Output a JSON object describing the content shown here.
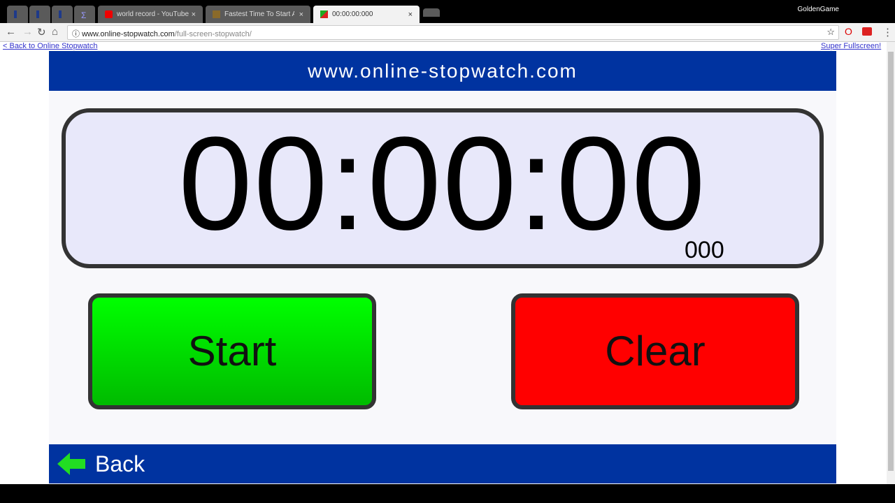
{
  "browser": {
    "tabs": [
      {
        "label": "",
        "icon": "L"
      },
      {
        "label": "",
        "icon": "L"
      },
      {
        "label": "",
        "icon": "L"
      },
      {
        "label": "",
        "icon": "sigma"
      },
      {
        "label": "world record - YouTube",
        "icon": "youtube"
      },
      {
        "label": "Fastest Time To Start An",
        "icon": "trophy"
      },
      {
        "label": "00:00:00:000",
        "icon": "stopwatch",
        "active": true
      }
    ],
    "user": "GoldenGame",
    "url_host": "www.online-stopwatch.com",
    "url_path": "/full-screen-stopwatch/"
  },
  "page": {
    "back_link": "< Back to Online Stopwatch",
    "super_fullscreen": "Super Fullscreen!",
    "header": "www.online-stopwatch.com",
    "time": "00:00:00",
    "milliseconds": "000",
    "start_label": "Start",
    "clear_label": "Clear",
    "back_label": "Back"
  }
}
